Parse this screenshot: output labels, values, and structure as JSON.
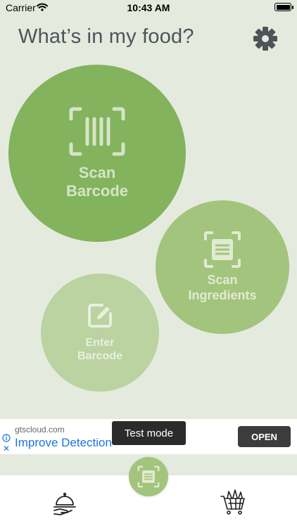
{
  "status_bar": {
    "carrier": "Carrier",
    "time": "10:43 AM"
  },
  "header": {
    "title": "What’s in my food?",
    "settings_icon": "gear-icon"
  },
  "actions": {
    "scan_barcode": {
      "line1": "Scan",
      "line2": "Barcode",
      "icon": "barcode-scan-icon",
      "color": "#83B35C"
    },
    "scan_ingredients": {
      "line1": "Scan",
      "line2": "Ingredients",
      "icon": "document-scan-icon",
      "color": "#A3C47C"
    },
    "enter_barcode": {
      "line1": "Enter",
      "line2": "Barcode",
      "icon": "edit-icon",
      "color": "#BAD3A0"
    }
  },
  "ad": {
    "domain": "gtscloud.com",
    "headline": "Improve Detection",
    "cta": "OPEN",
    "overlay": "Test mode"
  },
  "tab_bar": {
    "left_icon": "serving-tray-icon",
    "center_icon": "document-scan-icon",
    "right_icon": "shopping-cart-icon"
  }
}
